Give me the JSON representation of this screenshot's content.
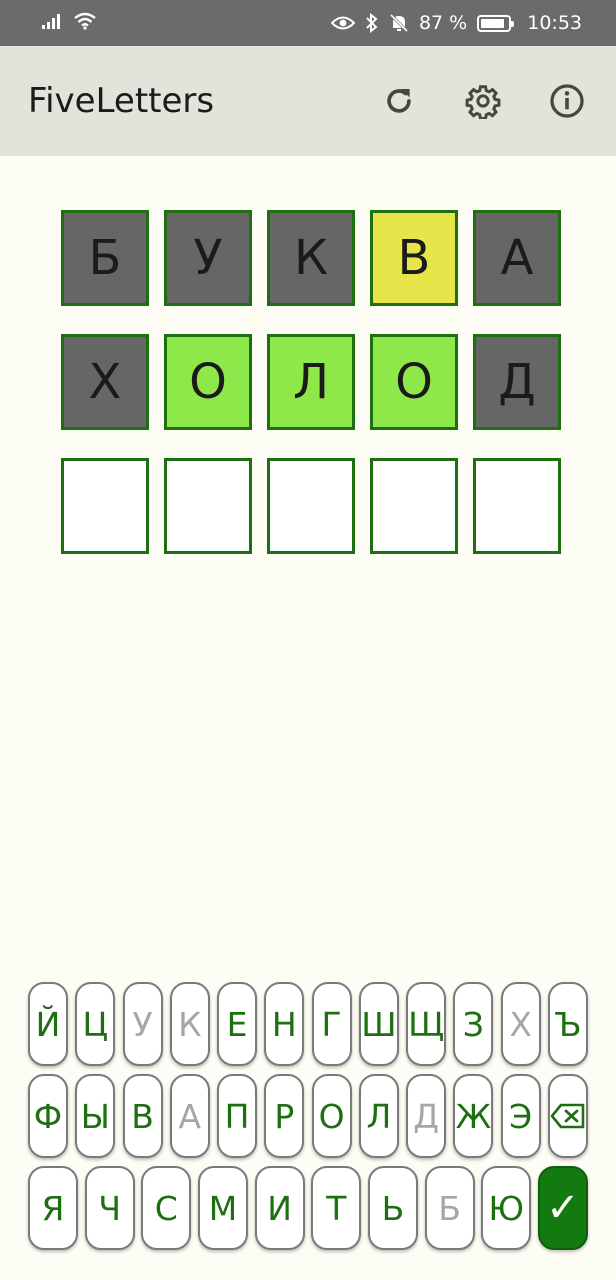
{
  "status_bar": {
    "battery_percent": "87 %",
    "battery_level": 0.87,
    "time": "10:53",
    "icons": [
      "signal-icon",
      "wifi-icon",
      "eye-icon",
      "bluetooth-icon",
      "bell-off-icon",
      "battery-icon"
    ]
  },
  "app_bar": {
    "title": "FiveLetters",
    "actions": [
      "refresh-icon",
      "settings-icon",
      "info-icon"
    ]
  },
  "colors": {
    "absent": "#666666",
    "present": "#e6e64a",
    "correct": "#8ee84a",
    "border": "#1e6e12",
    "key_text": "#1e6e12",
    "key_used": "#a6a6a6",
    "enter": "#137a0f"
  },
  "board": {
    "rows": [
      [
        {
          "letter": "Б",
          "state": "absent"
        },
        {
          "letter": "У",
          "state": "absent"
        },
        {
          "letter": "К",
          "state": "absent"
        },
        {
          "letter": "В",
          "state": "present"
        },
        {
          "letter": "А",
          "state": "absent"
        }
      ],
      [
        {
          "letter": "Х",
          "state": "absent"
        },
        {
          "letter": "О",
          "state": "correct"
        },
        {
          "letter": "Л",
          "state": "correct"
        },
        {
          "letter": "О",
          "state": "correct"
        },
        {
          "letter": "Д",
          "state": "absent"
        }
      ],
      [
        {
          "letter": "",
          "state": "empty"
        },
        {
          "letter": "",
          "state": "empty"
        },
        {
          "letter": "",
          "state": "empty"
        },
        {
          "letter": "",
          "state": "empty"
        },
        {
          "letter": "",
          "state": "empty"
        }
      ]
    ]
  },
  "keyboard": {
    "row1": [
      {
        "key": "Й",
        "used": false
      },
      {
        "key": "Ц",
        "used": false
      },
      {
        "key": "У",
        "used": true
      },
      {
        "key": "К",
        "used": true
      },
      {
        "key": "Е",
        "used": false
      },
      {
        "key": "Н",
        "used": false
      },
      {
        "key": "Г",
        "used": false
      },
      {
        "key": "Ш",
        "used": false
      },
      {
        "key": "Щ",
        "used": false
      },
      {
        "key": "З",
        "used": false
      },
      {
        "key": "Х",
        "used": true
      },
      {
        "key": "Ъ",
        "used": false
      }
    ],
    "row2": [
      {
        "key": "Ф",
        "used": false
      },
      {
        "key": "Ы",
        "used": false
      },
      {
        "key": "В",
        "used": false
      },
      {
        "key": "А",
        "used": true
      },
      {
        "key": "П",
        "used": false
      },
      {
        "key": "Р",
        "used": false
      },
      {
        "key": "О",
        "used": false
      },
      {
        "key": "Л",
        "used": false
      },
      {
        "key": "Д",
        "used": true
      },
      {
        "key": "Ж",
        "used": false
      },
      {
        "key": "Э",
        "used": false
      }
    ],
    "row3": [
      {
        "key": "Я",
        "used": false
      },
      {
        "key": "Ч",
        "used": false
      },
      {
        "key": "С",
        "used": false
      },
      {
        "key": "М",
        "used": false
      },
      {
        "key": "И",
        "used": false
      },
      {
        "key": "Т",
        "used": false
      },
      {
        "key": "Ь",
        "used": false
      },
      {
        "key": "Б",
        "used": true
      },
      {
        "key": "Ю",
        "used": false
      }
    ],
    "backspace_icon": "backspace-icon",
    "enter_label": "✓"
  }
}
